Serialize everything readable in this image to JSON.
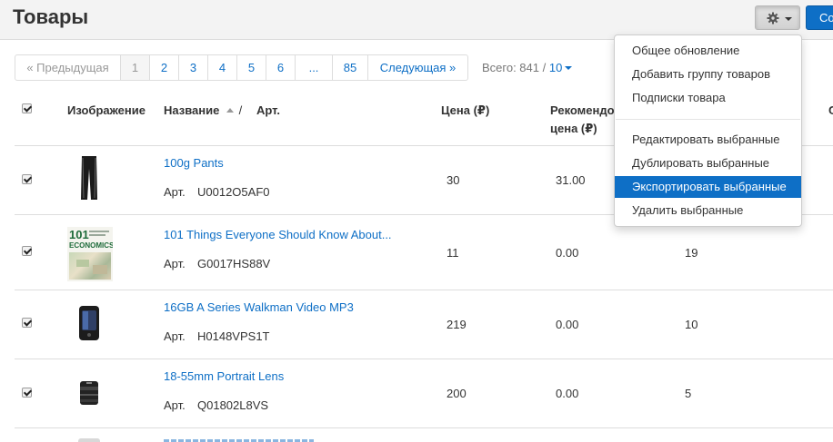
{
  "header": {
    "title": "Товары",
    "create_button": "Создать"
  },
  "pagination": {
    "prev": "« Предыдущая",
    "pages": [
      "1",
      "2",
      "3",
      "4",
      "5",
      "6",
      "...",
      "85"
    ],
    "active_page": "1",
    "next": "Следующая »",
    "total_label": "Всего: 841 /",
    "per_page": "10"
  },
  "table": {
    "headers": {
      "image": "Изображение",
      "name": "Название",
      "sort_sep": "/",
      "sku": "Арт.",
      "price": "Цена (₽)",
      "recommended_line1": "Рекомендо",
      "recommended_line2": "цена (₽)",
      "extra": "С"
    },
    "sku_label": "Арт.",
    "rows": [
      {
        "name": "100g Pants",
        "sku": "U0012O5AF0",
        "price": "30",
        "recommended": "31.00",
        "quantity": "",
        "thumb": "pants-thumbnail"
      },
      {
        "name": "101 Things Everyone Should Know About...",
        "sku": "G0017HS88V",
        "price": "11",
        "recommended": "0.00",
        "quantity": "19",
        "thumb": "book-thumbnail"
      },
      {
        "name": "16GB A Series Walkman Video MP3",
        "sku": "H0148VPS1T",
        "price": "219",
        "recommended": "0.00",
        "quantity": "10",
        "thumb": "mp3-player-thumbnail"
      },
      {
        "name": "18-55mm Portrait Lens",
        "sku": "Q01802L8VS",
        "price": "200",
        "recommended": "0.00",
        "quantity": "5",
        "thumb": "lens-thumbnail"
      }
    ],
    "thumb_text": {
      "book_number": "101",
      "book_title": "ECONOMICS"
    }
  },
  "dropdown": {
    "items": [
      "Общее обновление",
      "Добавить группу товаров",
      "Подписки товара",
      "Редактировать выбранные",
      "Дублировать выбранные",
      "Экспортировать выбранные",
      "Удалить выбранные"
    ],
    "highlighted_index": 5
  },
  "colors": {
    "accent": "#0e6fc6",
    "header_bg": "#f3f3f3"
  }
}
